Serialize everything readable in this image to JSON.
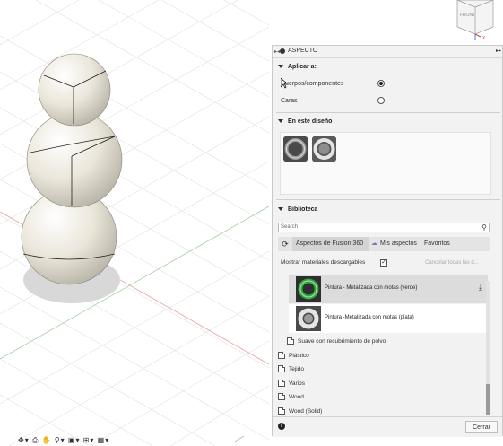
{
  "panel": {
    "title": "ASPECTO",
    "collapse_left": "▶◀",
    "collapse_right": "▸▸",
    "apply_section": {
      "title": "Aplicar a:",
      "options": [
        {
          "label": "Cuerpos/componentes",
          "selected": true
        },
        {
          "label": "Caras",
          "selected": false
        }
      ]
    },
    "design_section": {
      "title": "En este diseño",
      "thumbnails": [
        "dark-metal-ring",
        "silver-metal-ring"
      ]
    },
    "library_section": {
      "title": "Biblioteca",
      "search_placeholder": "Search",
      "tabs": [
        {
          "label": "Aspectos de Fusion 360",
          "active": true
        },
        {
          "label": "Mis aspectos",
          "active": false
        },
        {
          "label": "Favoritos",
          "active": false
        }
      ],
      "show_downloadable_label": "Mostrar materiales descargables",
      "show_downloadable_checked": true,
      "cancel_all_label": "Cancelar todas las d...",
      "materials": [
        {
          "label": "Pintura - Metalizada con motas (verde)",
          "color": "#35a844"
        },
        {
          "label": "Pintura -Metalizada con motas (plata)",
          "color": "#c9c9c9"
        }
      ],
      "sub_item": "Suave con recubrimiento de polvo",
      "folders": [
        "Plástico",
        "Tejido",
        "Varios",
        "Wood",
        "Wood (Solid)"
      ]
    },
    "footer": {
      "info_icon": "i",
      "close_label": "Cerrar"
    }
  },
  "viewcube": {
    "label": "FRONT"
  },
  "colors": {
    "sphere": "#e7e2d6",
    "shadow": "#d9d9d9",
    "grid": "#e3e3e3",
    "axis_red": "#e79a9a",
    "axis_green": "#9bc79b",
    "green_ring": "#35a844"
  }
}
